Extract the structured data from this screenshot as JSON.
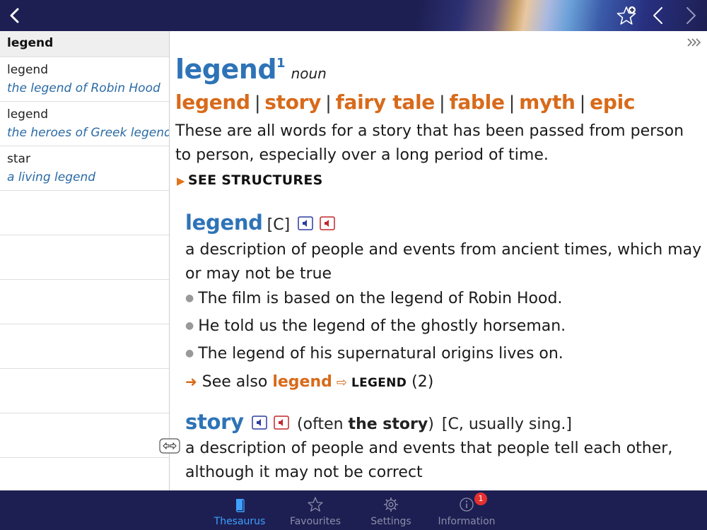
{
  "nav": {
    "back_icon": "chevron-left-icon",
    "favourite_icon": "star-add-icon",
    "prev_icon": "chevron-left-icon",
    "next_icon": "chevron-right-icon"
  },
  "sidebar": {
    "header": "legend",
    "items": [
      {
        "word": "legend",
        "example": "the legend of Robin Hood"
      },
      {
        "word": "legend",
        "example": "the heroes of Greek legend"
      },
      {
        "word": "star",
        "example": "a living legend"
      }
    ]
  },
  "entry": {
    "headword": "legend",
    "homograph": "1",
    "pos": "noun",
    "synonyms": [
      "legend",
      "story",
      "fairy tale",
      "fable",
      "myth",
      "epic"
    ],
    "separator": "|",
    "description": "These are all words for a story that has been passed from person to person, especially over a long period of time.",
    "see_structures": "SEE STRUCTURES",
    "senses": [
      {
        "word": "legend",
        "grammar": "[C]",
        "definition": "a description of people and events from ancient times, which may or may not be true",
        "examples": [
          "The film is based on the legend of Robin Hood.",
          "He told us the legend of the ghostly horseman.",
          "The legend of his supernatural origins lives on."
        ],
        "see_also_label": "See also",
        "see_also_word": "legend",
        "see_also_xref": "LEGEND",
        "see_also_num": "(2)"
      },
      {
        "word": "story",
        "grammar_pre": "(often ",
        "grammar_bold": "the story",
        "grammar_post": ")",
        "grammar2": "[C, usually sing.]",
        "definition": "a description of people and events that people tell each other, although it may not be correct"
      }
    ]
  },
  "tabs": [
    {
      "label": "Thesaurus",
      "icon": "book-icon",
      "active": true
    },
    {
      "label": "Favourites",
      "icon": "star-icon"
    },
    {
      "label": "Settings",
      "icon": "gear-icon"
    },
    {
      "label": "Information",
      "icon": "info-icon",
      "badge": "1"
    }
  ],
  "colors": {
    "bar": "#1d1f52",
    "headword": "#2e73b7",
    "synonym": "#d86a1a",
    "active_tab": "#3ea0ff",
    "badge": "#e53030"
  }
}
